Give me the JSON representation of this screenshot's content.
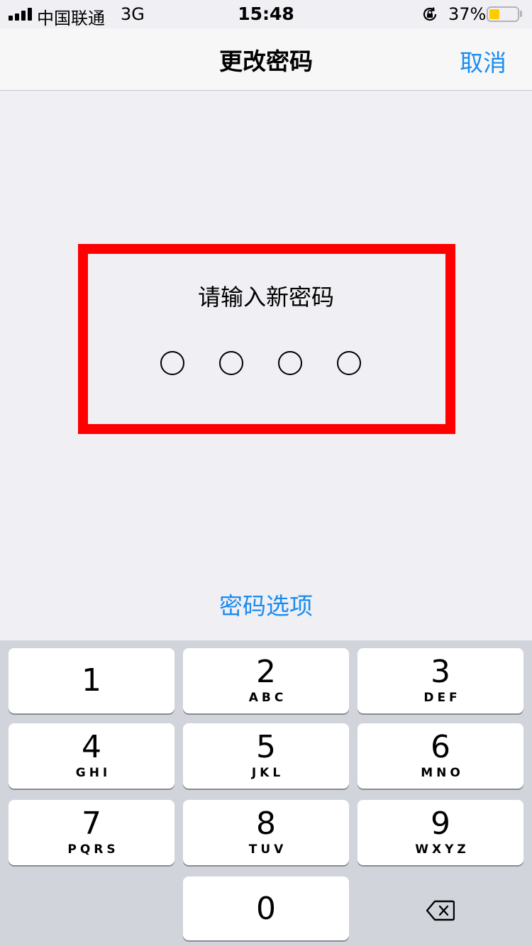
{
  "status_bar": {
    "carrier": "中国联通",
    "network": "3G",
    "time": "15:48",
    "battery_percent": "37%",
    "battery_level": 0.37,
    "icons": [
      "signal-icon",
      "orientation-lock-icon",
      "battery-icon"
    ]
  },
  "nav": {
    "title": "更改密码",
    "cancel_label": "取消"
  },
  "passcode": {
    "prompt": "请输入新密码",
    "digit_count": 4,
    "entered": 0,
    "options_label": "密码选项"
  },
  "keypad": {
    "keys": [
      {
        "digit": "1",
        "letters": ""
      },
      {
        "digit": "2",
        "letters": "ABC"
      },
      {
        "digit": "3",
        "letters": "DEF"
      },
      {
        "digit": "4",
        "letters": "GHI"
      },
      {
        "digit": "5",
        "letters": "JKL"
      },
      {
        "digit": "6",
        "letters": "MNO"
      },
      {
        "digit": "7",
        "letters": "PQRS"
      },
      {
        "digit": "8",
        "letters": "TUV"
      },
      {
        "digit": "9",
        "letters": "WXYZ"
      },
      {
        "digit": "0",
        "letters": ""
      }
    ],
    "delete_icon": "delete-backspace-icon"
  },
  "colors": {
    "accent": "#1a8cf0",
    "highlight": "#ff0000",
    "background": "#efeff4",
    "keypad_background": "#d1d5db",
    "battery": "#ffcc00"
  }
}
